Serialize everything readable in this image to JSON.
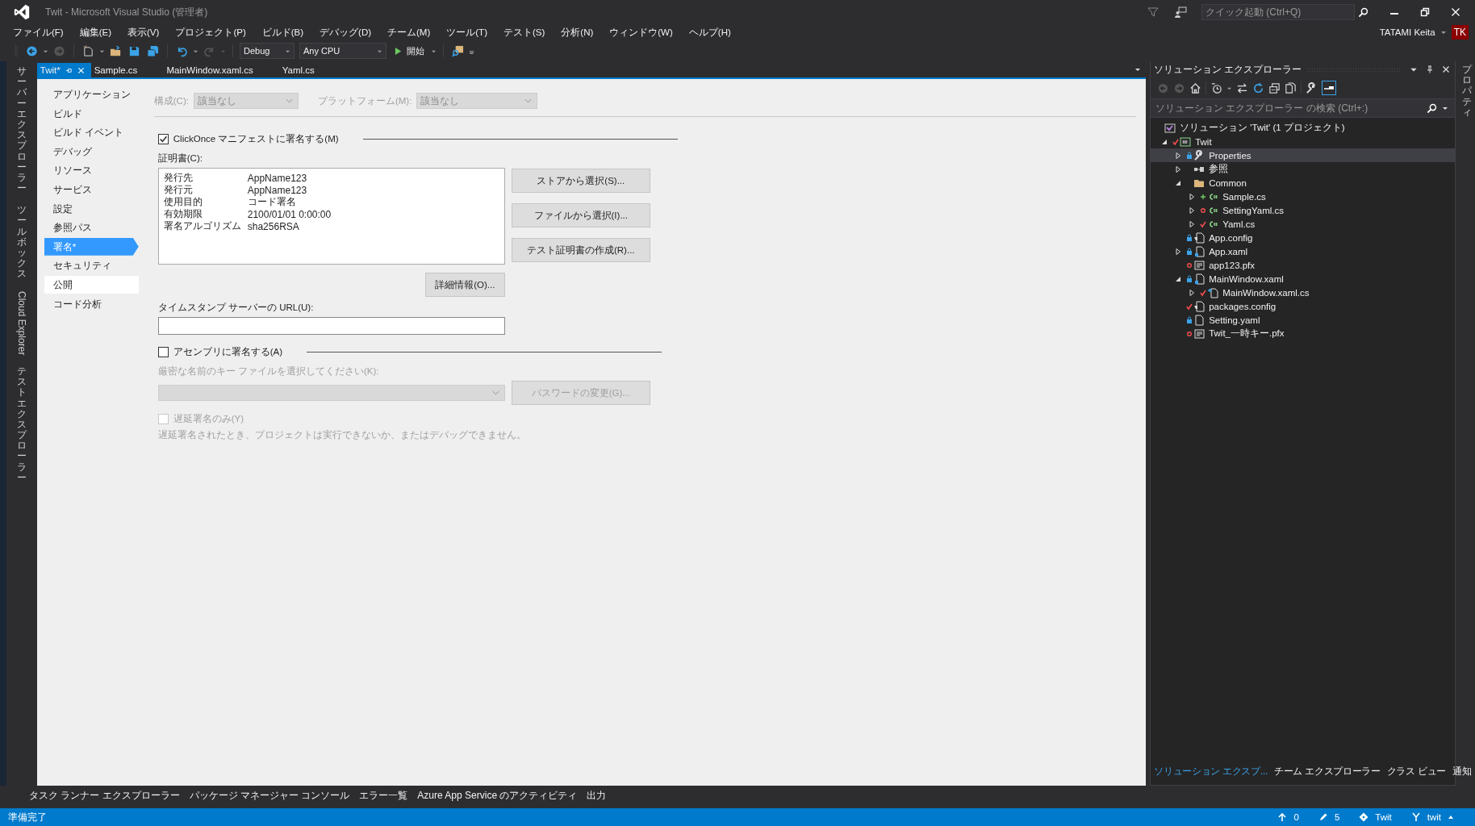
{
  "window": {
    "title": "Twit - Microsoft Visual Studio (管理者)"
  },
  "quick_launch": {
    "placeholder": "クイック起動 (Ctrl+Q)"
  },
  "menu": [
    "ファイル(F)",
    "編集(E)",
    "表示(V)",
    "プロジェクト(P)",
    "ビルド(B)",
    "デバッグ(D)",
    "チーム(M)",
    "ツール(T)",
    "テスト(S)",
    "分析(N)",
    "ウィンドウ(W)",
    "ヘルプ(H)"
  ],
  "account": {
    "name": "TATAMI Keita",
    "initials": "TK"
  },
  "toolbar": {
    "configuration": "Debug",
    "platform": "Any CPU",
    "start": "開始"
  },
  "left_tool_windows": [
    {
      "label": "サーバーエクスプローラー",
      "kind": "stacked"
    },
    {
      "label": "ツールボックス",
      "kind": "stacked"
    },
    {
      "label": "Cloud Explorer",
      "kind": "rotated"
    },
    {
      "label": "テストエクスプローラー",
      "kind": "stacked"
    }
  ],
  "doc_tabs": [
    {
      "label": "Twit*",
      "selected": true
    },
    {
      "label": "Sample.cs",
      "selected": false
    },
    {
      "label": "MainWindow.xaml.cs",
      "selected": false
    },
    {
      "label": "Yaml.cs",
      "selected": false
    }
  ],
  "property_pages": {
    "nav": [
      {
        "label": "アプリケーション",
        "selected": false,
        "hovered": false
      },
      {
        "label": "ビルド",
        "selected": false,
        "hovered": false
      },
      {
        "label": "ビルド イベント",
        "selected": false,
        "hovered": false
      },
      {
        "label": "デバッグ",
        "selected": false,
        "hovered": false
      },
      {
        "label": "リソース",
        "selected": false,
        "hovered": false
      },
      {
        "label": "サービス",
        "selected": false,
        "hovered": false
      },
      {
        "label": "設定",
        "selected": false,
        "hovered": false
      },
      {
        "label": "参照パス",
        "selected": false,
        "hovered": false
      },
      {
        "label": "署名*",
        "selected": true,
        "hovered": false
      },
      {
        "label": "セキュリティ",
        "selected": false,
        "hovered": false
      },
      {
        "label": "公開",
        "selected": false,
        "hovered": true
      },
      {
        "label": "コード分析",
        "selected": false,
        "hovered": false
      }
    ],
    "configuration": {
      "label": "構成(C):",
      "value": "該当なし",
      "disabled": true
    },
    "platform": {
      "label": "プラットフォーム(M):",
      "value": "該当なし",
      "disabled": true
    },
    "clickonce": {
      "label": "ClickOnce マニフェストに署名する(M)",
      "checked": true
    },
    "certificate": {
      "label": "証明書(C):",
      "rows": [
        {
          "field": "発行先",
          "value": "AppName123"
        },
        {
          "field": "発行元",
          "value": "AppName123"
        },
        {
          "field": "使用目的",
          "value": "コード署名"
        },
        {
          "field": "有効期限",
          "value": "2100/01/01 0:00:00"
        },
        {
          "field": "署名アルゴリズム",
          "value": "sha256RSA"
        }
      ]
    },
    "cert_buttons": [
      "ストアから選択(S)...",
      "ファイルから選択(I)...",
      "テスト証明書の作成(R)..."
    ],
    "details_button": "詳細情報(O)...",
    "timestamp": {
      "label": "タイムスタンプ サーバーの URL(U):"
    },
    "assembly_sign": {
      "label": "アセンブリに署名する(A)",
      "checked": false
    },
    "key_file": {
      "label": "厳密な名前のキー ファイルを選択してください(K):",
      "disabled": true
    },
    "password_button": {
      "label": "パスワードの変更(G)...",
      "disabled": true
    },
    "delay_sign": {
      "label": "遅延署名のみ(Y)",
      "checked": false,
      "disabled": true
    },
    "delay_note": "遅延署名されたとき、プロジェクトは実行できないか、またはデバッグできません。"
  },
  "solution_explorer": {
    "title": "ソリューション エクスプローラー",
    "search": {
      "placeholder": "ソリューション エクスプローラー の検索 (Ctrl+:)"
    },
    "tree": [
      {
        "label": "ソリューション 'Twit' (1 プロジェクト)",
        "kind": "solution",
        "selected": false,
        "children": [
          {
            "label": "Twit",
            "kind": "project",
            "source_control": {
              "kind": "modified"
            },
            "expanded": true,
            "selected": false,
            "children": [
              {
                "label": "Properties",
                "kind": "properties",
                "source_control": {
                  "kind": "locked"
                },
                "expanded": false,
                "selected": true
              },
              {
                "label": "参照",
                "kind": "references",
                "expanded": false,
                "selected": false
              },
              {
                "label": "Common",
                "kind": "folder",
                "expanded": true,
                "selected": false,
                "children": [
                  {
                    "label": "Sample.cs",
                    "kind": "cs",
                    "source_control": {
                      "kind": "added"
                    },
                    "expanded": false,
                    "selected": false
                  },
                  {
                    "label": "SettingYaml.cs",
                    "kind": "cs",
                    "source_control": {
                      "kind": "excluded"
                    },
                    "expanded": false,
                    "selected": false
                  },
                  {
                    "label": "Yaml.cs",
                    "kind": "cs",
                    "source_control": {
                      "kind": "modified"
                    },
                    "expanded": false,
                    "selected": false
                  }
                ]
              },
              {
                "label": "App.config",
                "kind": "config",
                "source_control": {
                  "kind": "locked"
                },
                "selected": false
              },
              {
                "label": "App.xaml",
                "kind": "xaml",
                "source_control": {
                  "kind": "locked"
                },
                "expanded": false,
                "selected": false
              },
              {
                "label": "app123.pfx",
                "kind": "pfx",
                "source_control": {
                  "kind": "excluded"
                },
                "selected": false
              },
              {
                "label": "MainWindow.xaml",
                "kind": "xaml",
                "source_control": {
                  "kind": "locked"
                },
                "expanded": true,
                "selected": false,
                "children": [
                  {
                    "label": "MainWindow.xaml.cs",
                    "kind": "codebehind",
                    "source_control": {
                      "kind": "modified"
                    },
                    "expanded": false,
                    "selected": false
                  }
                ]
              },
              {
                "label": "packages.config",
                "kind": "config",
                "source_control": {
                  "kind": "modified"
                },
                "selected": false
              },
              {
                "label": "Setting.yaml",
                "kind": "file",
                "source_control": {
                  "kind": "locked"
                },
                "selected": false
              },
              {
                "label": "Twit_一時キー.pfx",
                "kind": "pfx",
                "source_control": {
                  "kind": "excluded"
                },
                "selected": false
              }
            ]
          }
        ]
      }
    ],
    "tabs": [
      {
        "label": "ソリューション エクスプ...",
        "selected": true
      },
      {
        "label": "チーム エクスプローラー",
        "selected": false
      },
      {
        "label": "クラス ビュー",
        "selected": false
      },
      {
        "label": "通知",
        "selected": false
      }
    ]
  },
  "properties_strip": "プロパティ",
  "bottom_tabs": [
    "タスク ランナー エクスプローラー",
    "パッケージ マネージャー コンソール",
    "エラー一覧",
    "Azure App Service のアクティビティ",
    "出力"
  ],
  "status_bar": {
    "text": "準備完了",
    "pushes": "0",
    "changes": "5",
    "repository": "Twit",
    "branch": "twit"
  }
}
